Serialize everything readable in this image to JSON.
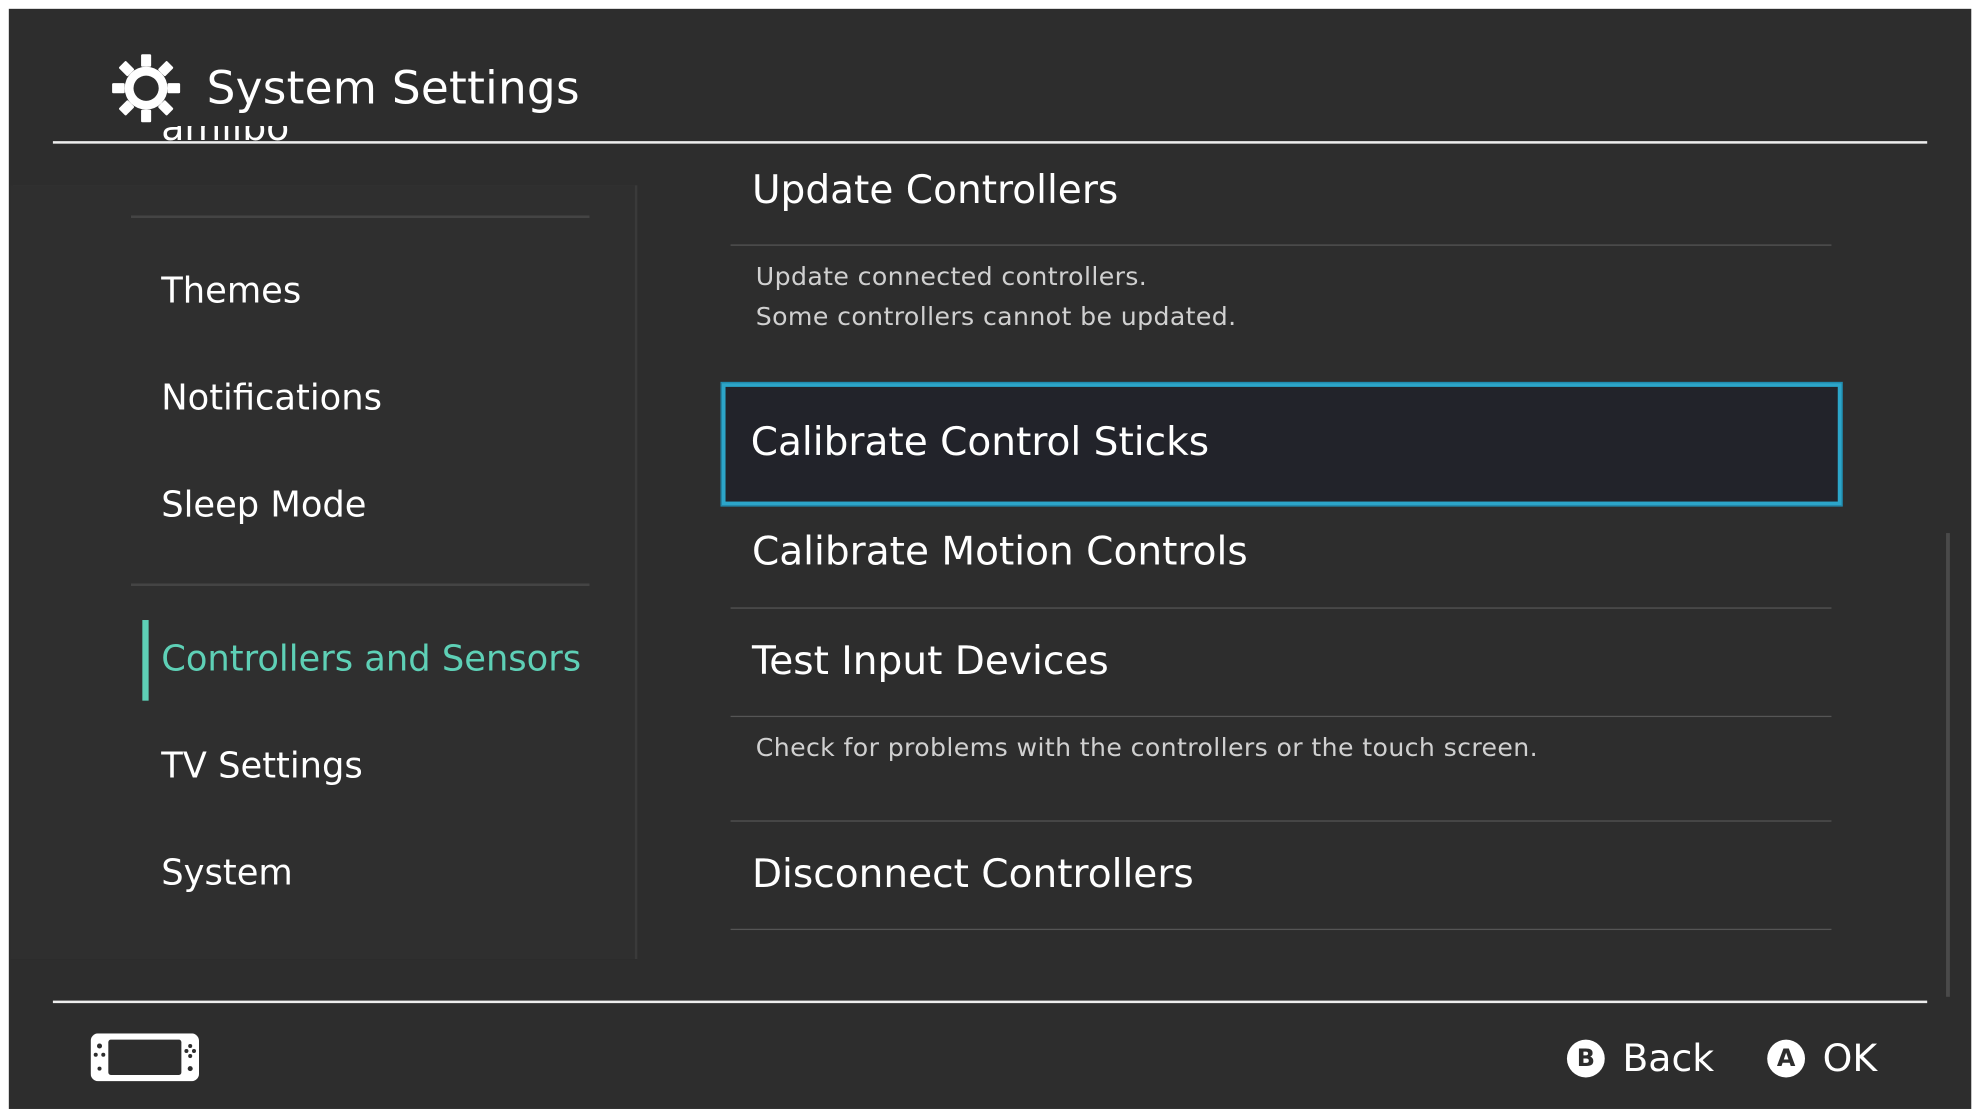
{
  "header": {
    "title": "System Settings",
    "icon": "gear-icon"
  },
  "sidebar": {
    "clipped_item": "amiibo",
    "items": [
      {
        "label": "Themes"
      },
      {
        "label": "Notifications"
      },
      {
        "label": "Sleep Mode"
      },
      {
        "label": "Controllers and Sensors",
        "active": true
      },
      {
        "label": "TV Settings"
      },
      {
        "label": "System"
      }
    ]
  },
  "main": {
    "items": [
      {
        "label": "Update Controllers",
        "description_lines": [
          "Update connected controllers.",
          "Some controllers cannot be updated."
        ]
      },
      {
        "label": "Calibrate Control Sticks",
        "selected": true
      },
      {
        "label": "Calibrate Motion Controls"
      },
      {
        "label": "Test Input Devices",
        "description_lines": [
          "Check for problems with the controllers or the touch screen."
        ]
      },
      {
        "label": "Disconnect Controllers"
      }
    ]
  },
  "footer": {
    "console_icon": "handheld-console-icon",
    "back": {
      "key": "B",
      "label": "Back"
    },
    "ok": {
      "key": "A",
      "label": "OK"
    }
  },
  "colors": {
    "background": "#2d2d2d",
    "accent_active": "#5ed0b6",
    "selection_border": "#2ca5c9",
    "text": "#ffffff"
  }
}
